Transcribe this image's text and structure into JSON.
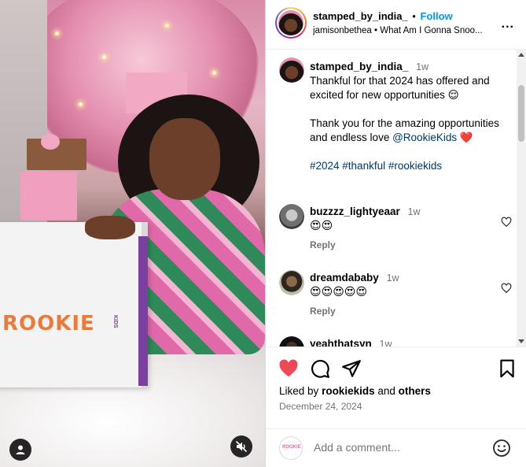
{
  "media": {
    "brand_text": "ROOKIE",
    "brand_sub": "KIDS",
    "tag_icon": "person-tag-icon",
    "mute_icon": "muted-speaker-icon"
  },
  "header": {
    "username": "stamped_by_india_",
    "separator": "•",
    "follow_label": "Follow",
    "subtitle": "jamisonbethea • What Am I Gonna Snoo...",
    "more_label": "..."
  },
  "caption": {
    "username": "stamped_by_india_",
    "time": "1w",
    "line1": "Thankful for that 2024 has offered and excited for new opportunities 😌",
    "line2": "Thank you for the amazing opportunities and endless love",
    "mention": "@RookieKids",
    "heart": "❤️",
    "hashtags": "#2024 #thankful #rookiekids"
  },
  "comments": [
    {
      "username": "buzzzz_lightyeaar",
      "time": "1w",
      "text": "😍😍",
      "reply_label": "Reply"
    },
    {
      "username": "dreamdababy",
      "time": "1w",
      "text": "😍😍😍😍😍",
      "reply_label": "Reply"
    },
    {
      "username": "yeahthatsyn",
      "time": "1w"
    }
  ],
  "actions": {
    "liked_prefix": "Liked by",
    "liked_user": "rookiekids",
    "liked_and": "and",
    "liked_others": "others",
    "date": "December 24, 2024",
    "add_comment_placeholder": "Add a comment...",
    "mini_logo": "ROOKIE"
  },
  "colors": {
    "accent": "#0095f6",
    "like_red": "#ed4956",
    "muted": "#737373"
  }
}
